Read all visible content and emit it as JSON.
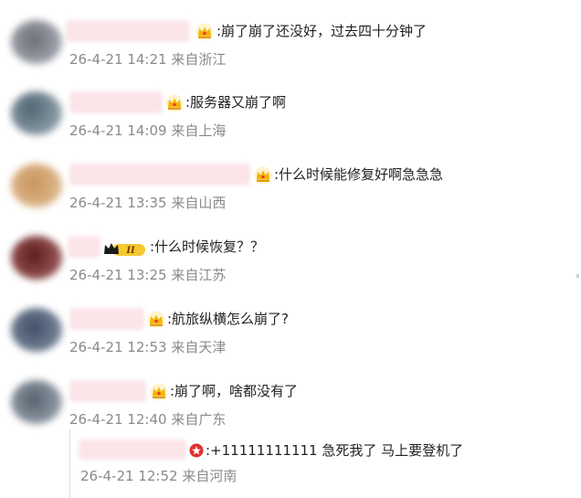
{
  "comments": [
    {
      "text": ":崩了崩了还没好，过去四十分钟了",
      "time": "26-4-21 14:21",
      "source": "来自浙江",
      "badge": "crown-icon"
    },
    {
      "text": ":服务器又崩了啊",
      "time": "26-4-21 14:09",
      "source": "来自上海",
      "badge": "crown-icon"
    },
    {
      "text": ":什么时候能修复好啊急急急",
      "time": "26-4-21 13:35",
      "source": "来自山西",
      "badge": "crown-icon"
    },
    {
      "text": ":什么时候恢复？？",
      "time": "26-4-21 13:25",
      "source": "来自江苏",
      "badge": "vip-level-badge"
    },
    {
      "text": ":航旅纵横怎么崩了?",
      "time": "26-4-21 12:53",
      "source": "来自天津",
      "badge": "crown-icon"
    },
    {
      "text": ":崩了啊，啥都没有了",
      "time": "26-4-21 12:40",
      "source": "来自广东",
      "badge": "crown-icon"
    }
  ],
  "reply": {
    "text": ":+11111111111 急死我了 马上要登机了",
    "time": "26-4-21 12:52",
    "source": "来自河南",
    "badge": "red-star-badge"
  },
  "badge_level": "II",
  "colors": {
    "text": "#222222",
    "meta": "#8a8a8a",
    "name_blur": "#fbe5e9",
    "crown": "#f5b400"
  }
}
